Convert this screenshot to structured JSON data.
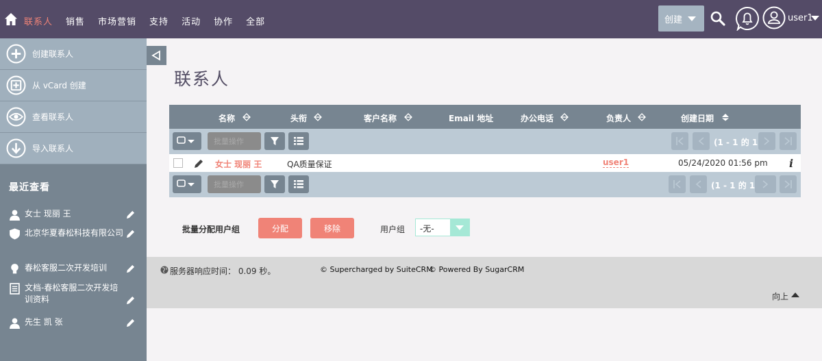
{
  "nav": {
    "items": [
      "联系人",
      "销售",
      "市场营销",
      "支持",
      "活动",
      "协作",
      "全部"
    ],
    "create_label": "创建",
    "user_label": "user1"
  },
  "sidebar": {
    "actions": [
      {
        "label": "创建联系人",
        "icon": "plus-circle-icon"
      },
      {
        "label": "从 vCard 创建",
        "icon": "vcard-icon"
      },
      {
        "label": "查看联系人",
        "icon": "eye-icon"
      },
      {
        "label": "导入联系人",
        "icon": "import-icon"
      }
    ],
    "recent_title": "最近查看",
    "recent": [
      {
        "label": "女士 现丽 王",
        "icon": "person-icon"
      },
      {
        "label": "北京华夏春松科技有限公司",
        "icon": "shield-icon"
      },
      {
        "label": "春松客服二次开发培训",
        "icon": "bulb-icon"
      },
      {
        "label": "文档-春松客服二次开发培训资料",
        "icon": "document-icon"
      },
      {
        "label": "先生 凯 张",
        "icon": "person-icon"
      }
    ]
  },
  "main": {
    "title": "联系人",
    "columns": [
      "名称",
      "头衔",
      "客户名称",
      "Email 地址",
      "办公电话",
      "负责人",
      "创建日期"
    ],
    "bulk_label": "批量操作",
    "pagination_top": "(1 - 1 的 1)",
    "pagination_bottom": "(1 - 1 的 1)",
    "rows": [
      {
        "name": "女士 现丽 王",
        "title": "QA质量保证",
        "account": "",
        "email": "",
        "phone": "",
        "owner": "user1",
        "created": "05/24/2020 01:56 pm",
        "info": "i"
      }
    ]
  },
  "mass_assign": {
    "label": "批量分配用户组",
    "assign_label": "分配",
    "remove_label": "移除",
    "group_label": "用户组",
    "group_value": "-无-"
  },
  "footer": {
    "response": "服务器响应时间： 0.09 秒。",
    "supercharged": "© Supercharged by SuiteCRM",
    "powered": "© Powered By SugarCRM",
    "back_to_top": "向上"
  },
  "colors": {
    "topbar": "#544b67",
    "accent": "#f08377",
    "sidebar": "#778591",
    "sidebar_action": "#a0b0bd",
    "table_header": "#778591",
    "toolbar": "#bccad5",
    "select_accent": "#a5e8d6"
  }
}
